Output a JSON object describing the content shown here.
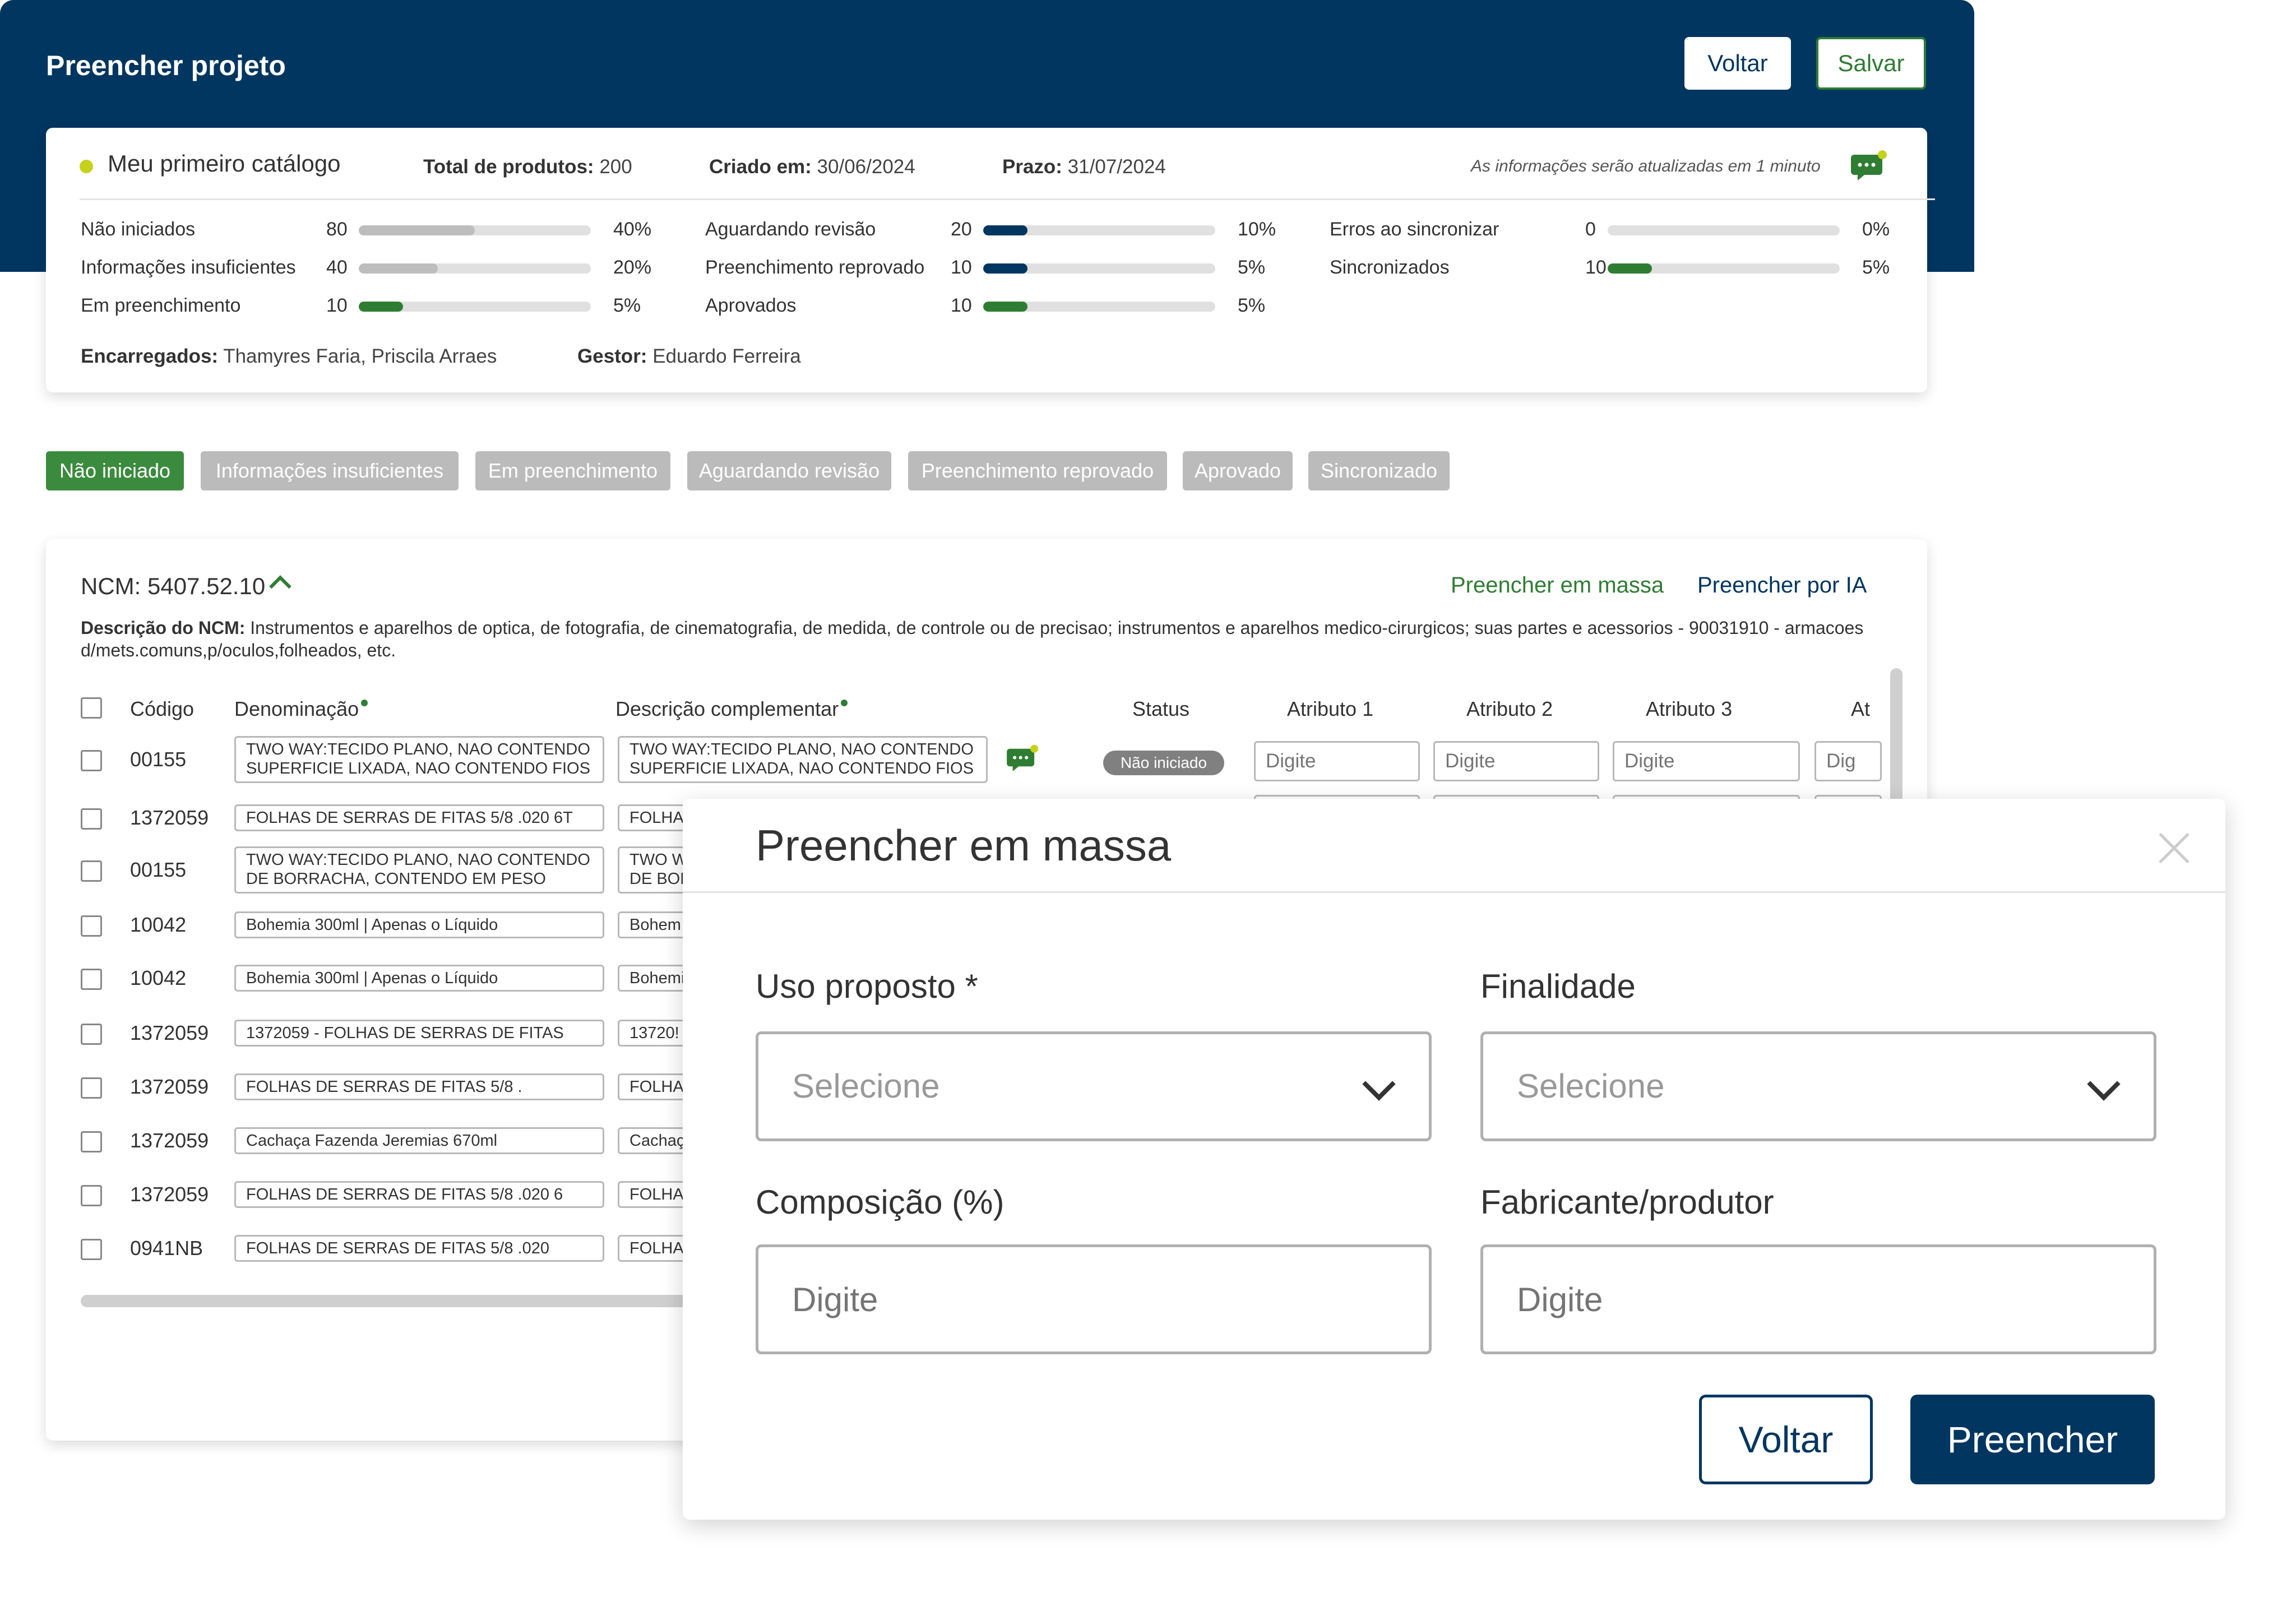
{
  "header": {
    "title": "Preencher projeto",
    "back_label": "Voltar",
    "save_label": "Salvar"
  },
  "summary": {
    "catalog_name": "Meu primeiro catálogo",
    "total_label": "Total de produtos:",
    "total_value": "200",
    "created_label": "Criado em:",
    "created_value": "30/06/2024",
    "deadline_label": "Prazo:",
    "deadline_value": "31/07/2024",
    "update_note": "As informações serão atualizadas em 1 minuto",
    "stats": [
      {
        "label": "Não iniciados",
        "count": "80",
        "percent": "40%",
        "progress": 0.5,
        "color": "#bdbdbd"
      },
      {
        "label": "Informações insuficientes",
        "count": "40",
        "percent": "20%",
        "progress": 0.34,
        "color": "#bdbdbd"
      },
      {
        "label": "Em preenchimento",
        "count": "10",
        "percent": "5%",
        "progress": 0.19,
        "color": "#2e7d32"
      },
      {
        "label": "Aguardando revisão",
        "count": "20",
        "percent": "10%",
        "progress": 0.19,
        "color": "#013661"
      },
      {
        "label": "Preenchimento reprovado",
        "count": "10",
        "percent": "5%",
        "progress": 0.19,
        "color": "#013661"
      },
      {
        "label": "Aprovados",
        "count": "10",
        "percent": "5%",
        "progress": 0.19,
        "color": "#2e7d32"
      },
      {
        "label": "Erros ao sincronizar",
        "count": "0",
        "percent": "0%",
        "progress": 0,
        "color": "#c62828"
      },
      {
        "label": "Sincronizados",
        "count": "10",
        "percent": "5%",
        "progress": 0.19,
        "color": "#2e7d32"
      }
    ],
    "assignees_label": "Encarregados:",
    "assignees_value": "Thamyres Faria, Priscila Arraes",
    "manager_label": "Gestor:",
    "manager_value": "Eduardo Ferreira"
  },
  "filters": [
    "Não iniciado",
    "Informações insuficientes",
    "Em preenchimento",
    "Aguardando revisão",
    "Preenchimento reprovado",
    "Aprovado",
    "Sincronizado"
  ],
  "ncm": {
    "title": "NCM: 5407.52.10",
    "mass_fill_link": "Preencher em massa",
    "ai_fill_link": "Preencher por IA",
    "desc_label": "Descrição do NCM:",
    "desc_text": "Instrumentos e aparelhos de optica, de fotografia, de cinematografia, de medida, de controle ou de precisao; instrumentos e aparelhos medico-cirurgicos; suas partes e acessorios - 90031910 - armacoes d/mets.comuns,p/oculos,folheados, etc."
  },
  "table": {
    "columns": {
      "code": "Código",
      "name": "Denominação",
      "desc": "Descrição complementar",
      "status": "Status",
      "attr1": "Atributo 1",
      "attr2": "Atributo 2",
      "attr3": "Atributo 3",
      "attr4": "At"
    },
    "first_row_status": "Não iniciado",
    "attr_placeholder": "Digite",
    "attr_partial_placeholder": "Dig",
    "rows": [
      {
        "code": "00155",
        "name_l1": "TWO WAY:TECIDO PLANO, NAO CONTENDO",
        "name_l2": "SUPERFICIE LIXADA, NAO CONTENDO FIOS",
        "desc_l1": "TWO WAY:TECIDO PLANO, NAO CONTENDO",
        "desc_l2": "SUPERFICIE LIXADA, NAO CONTENDO FIOS"
      },
      {
        "code": "1372059",
        "name_l1": "FOLHAS DE SERRAS DE FITAS 5/8 .020 6T",
        "name_l2": "",
        "desc_l1": "FOLHA",
        "desc_l2": ""
      },
      {
        "code": "00155",
        "name_l1": "TWO WAY:TECIDO PLANO, NAO CONTENDO",
        "name_l2": "DE BORRACHA, CONTENDO EM PESO",
        "desc_l1": "TWO W",
        "desc_l2": "DE BOR"
      },
      {
        "code": "10042",
        "name_l1": "Bohemia 300ml | Apenas o Líquido",
        "name_l2": "",
        "desc_l1": "Bohem",
        "desc_l2": ""
      },
      {
        "code": "10042",
        "name_l1": "Bohemia 300ml | Apenas o Líquido",
        "name_l2": "",
        "desc_l1": "Bohemi",
        "desc_l2": ""
      },
      {
        "code": "1372059",
        "name_l1": "1372059 - FOLHAS DE SERRAS DE FITAS",
        "name_l2": "",
        "desc_l1": "13720!",
        "desc_l2": ""
      },
      {
        "code": "1372059",
        "name_l1": "FOLHAS DE SERRAS DE FITAS 5/8 .",
        "name_l2": "",
        "desc_l1": "FOLHAS",
        "desc_l2": ""
      },
      {
        "code": "1372059",
        "name_l1": "Cachaça Fazenda Jeremias 670ml",
        "name_l2": "",
        "desc_l1": "Cachaç",
        "desc_l2": ""
      },
      {
        "code": "1372059",
        "name_l1": "FOLHAS DE SERRAS DE FITAS 5/8 .020 6",
        "name_l2": "",
        "desc_l1": "FOLHAS",
        "desc_l2": ""
      },
      {
        "code": "0941NB",
        "name_l1": "FOLHAS DE SERRAS DE FITAS 5/8 .020",
        "name_l2": "",
        "desc_l1": "FOLHA",
        "desc_l2": ""
      }
    ]
  },
  "modal": {
    "title": "Preencher em massa",
    "uso_label": "Uso proposto *",
    "uso_placeholder": "Selecione",
    "finalidade_label": "Finalidade",
    "finalidade_placeholder": "Selecione",
    "composicao_label": "Composição (%)",
    "composicao_placeholder": "Digite",
    "fabricante_label": "Fabricante/produtor",
    "fabricante_placeholder": "Digite",
    "back_label": "Voltar",
    "fill_label": "Preencher"
  },
  "colors": {
    "primary": "#013661",
    "green": "#2e7d32",
    "chip_active": "#3b8b3e",
    "chip_inactive": "#bbbbbb",
    "status_badge": "#808080",
    "notification_dot": "#c5d21b"
  }
}
